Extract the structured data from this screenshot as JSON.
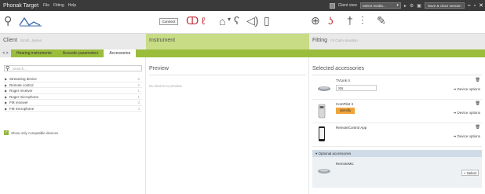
{
  "titlebar": {
    "app_title": "Phonak Target",
    "menus": [
      "File",
      "Fitting",
      "Help"
    ],
    "client_view_label": "Client view",
    "select_media": "Select media...",
    "save_close": "Save & close session"
  },
  "toolbar": {
    "connect_label": "Connect"
  },
  "sections": {
    "client_title": "Client",
    "client_name": "Smith, James",
    "instrument_title": "Instrument",
    "fitting_title": "Fitting",
    "fitting_sub": "Fit Calm situation"
  },
  "tabs": {
    "arrows": "< >",
    "items": [
      "Hearing instruments",
      "Acoustic parameters",
      "Accessories"
    ]
  },
  "left": {
    "search_placeholder": "Search...",
    "devices": [
      {
        "label": "Streaming device",
        "count": "6"
      },
      {
        "label": "Remote control",
        "count": "2"
      },
      {
        "label": "Roger receiver",
        "count": "1"
      },
      {
        "label": "Roger microphone",
        "count": "1"
      },
      {
        "label": "FM receiver",
        "count": "3"
      },
      {
        "label": "FM microphone",
        "count": "4"
      }
    ],
    "compat_label": "Show only compatible devices"
  },
  "preview": {
    "title": "Preview",
    "empty": "No device to preview"
  },
  "selected": {
    "title": "Selected accessories",
    "items": [
      {
        "name": "TVLink II",
        "sn_label": "SN",
        "options": "Device options"
      },
      {
        "name": "ComPilot II",
        "identify": "Identify",
        "options": "Device options"
      },
      {
        "name": "RemoteControl App",
        "options": "Device options"
      }
    ],
    "optional_header": "Optional accessories",
    "optional_item": "RemoteMic",
    "select_label": "Select"
  }
}
